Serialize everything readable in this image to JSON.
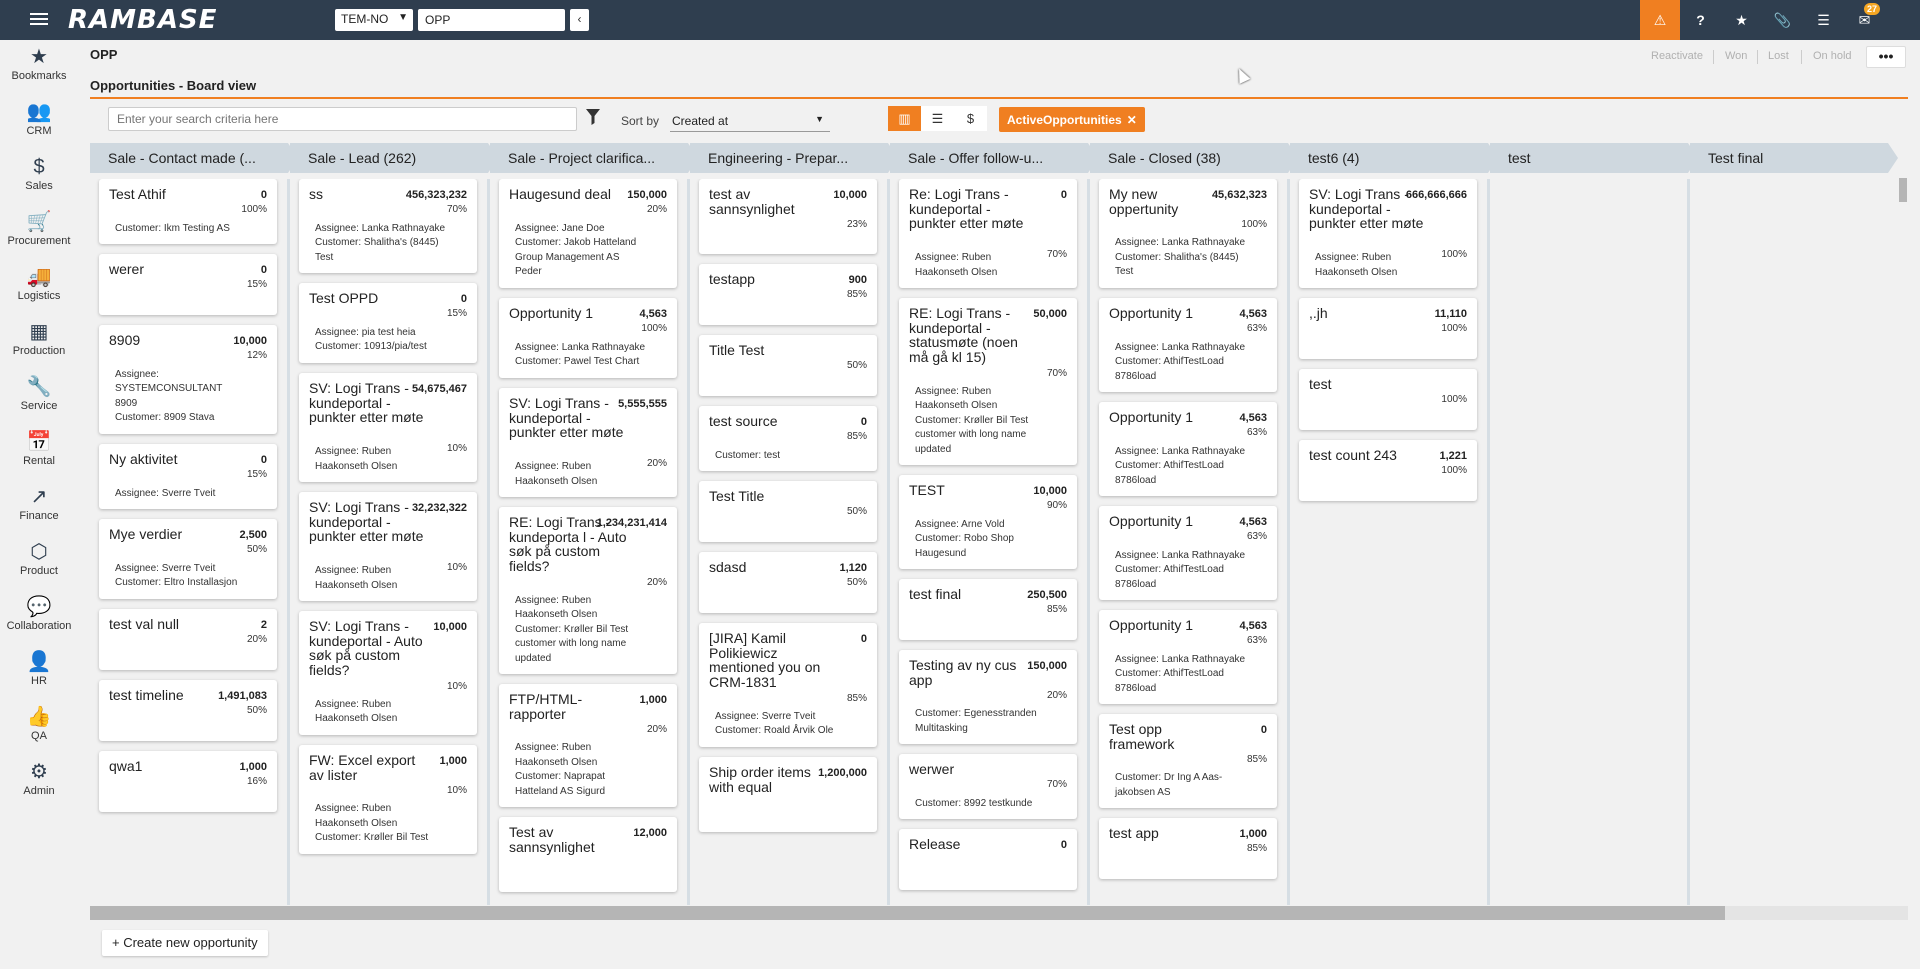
{
  "topbar": {
    "logo": "RAMBASE",
    "company": "TEM-NO",
    "program_input": "OPP",
    "back": "‹",
    "mail_count": "27"
  },
  "sidebar": {
    "items": [
      {
        "icon": "★",
        "label": "Bookmarks"
      },
      {
        "icon": "👥",
        "label": "CRM"
      },
      {
        "icon": "$",
        "label": "Sales"
      },
      {
        "icon": "🛒",
        "label": "Procurement"
      },
      {
        "icon": "🚚",
        "label": "Logistics"
      },
      {
        "icon": "▦",
        "label": "Production"
      },
      {
        "icon": "🔧",
        "label": "Service"
      },
      {
        "icon": "📅",
        "label": "Rental"
      },
      {
        "icon": "↗",
        "label": "Finance"
      },
      {
        "icon": "⬡",
        "label": "Product"
      },
      {
        "icon": "💬",
        "label": "Collaboration"
      },
      {
        "icon": "👤",
        "label": "HR"
      },
      {
        "icon": "👍",
        "label": "QA"
      },
      {
        "icon": "⚙",
        "label": "Admin"
      }
    ]
  },
  "header": {
    "program_title": "OPP",
    "view_title": "Opportunities - Board view",
    "state_buttons": [
      "Reactivate",
      "Won",
      "Lost",
      "On hold"
    ],
    "more": "•••"
  },
  "toolbar": {
    "search_placeholder": "Enter your search criteria here",
    "sort_label": "Sort by",
    "sort_value": "Created at",
    "active_filter": "ActiveOpportunities"
  },
  "columns": [
    {
      "title": "Sale - Contact made (...",
      "cards": [
        {
          "name": "Test Athif",
          "amount": "0",
          "pct": "100%",
          "lines": [
            "Customer: Ikm Testing AS"
          ]
        },
        {
          "name": "werer",
          "amount": "0",
          "pct": "15%",
          "lines": []
        },
        {
          "name": "8909",
          "amount": "10,000",
          "pct": "12%",
          "lines": [
            "Assignee: SYSTEMCONSULTANT 8909",
            "Customer: 8909 Stava"
          ]
        },
        {
          "name": "Ny aktivitet",
          "amount": "0",
          "pct": "15%",
          "lines": [
            "Assignee: Sverre Tveit"
          ]
        },
        {
          "name": "Mye verdier",
          "amount": "2,500",
          "pct": "50%",
          "lines": [
            "Assignee: Sverre Tveit",
            "Customer: Eltro Installasjon"
          ]
        },
        {
          "name": "test val null",
          "amount": "2",
          "pct": "20%",
          "lines": []
        },
        {
          "name": "test timeline",
          "amount": "1,491,083",
          "pct": "50%",
          "lines": []
        },
        {
          "name": "qwa1",
          "amount": "1,000",
          "pct": "16%",
          "lines": []
        }
      ]
    },
    {
      "title": "Sale - Lead (262)",
      "cards": [
        {
          "name": "ss",
          "amount": "456,323,232",
          "pct": "70%",
          "lines": [
            "Assignee: Lanka Rathnayake",
            "Customer: Shalitha's (8445) Test"
          ]
        },
        {
          "name": "Test OPPD",
          "amount": "0",
          "pct": "15%",
          "lines": [
            "Assignee: pia test heia",
            "Customer: 10913/pia/test"
          ]
        },
        {
          "name": "SV: Logi Trans - kundeportal - punkter etter møte",
          "amount": "54,675,467",
          "pct": "10%",
          "lines": [
            "Assignee: Ruben Haakonseth Olsen"
          ]
        },
        {
          "name": "SV: Logi Trans - kundeportal - punkter etter møte",
          "amount": "32,232,322",
          "pct": "10%",
          "lines": [
            "Assignee: Ruben Haakonseth Olsen"
          ]
        },
        {
          "name": "SV: Logi Trans - kundeportal - Auto søk på custom fields?",
          "amount": "10,000",
          "pct": "10%",
          "lines": [
            "Assignee: Ruben Haakonseth Olsen"
          ]
        },
        {
          "name": "FW: Excel export av lister",
          "amount": "1,000",
          "pct": "10%",
          "lines": [
            "Assignee: Ruben Haakonseth Olsen",
            "Customer: Krøller Bil Test"
          ]
        }
      ]
    },
    {
      "title": "Sale - Project clarifica...",
      "cards": [
        {
          "name": "Haugesund deal",
          "amount": "150,000",
          "pct": "20%",
          "lines": [
            "Assignee: Jane Doe",
            "Customer: Jakob Hatteland Group Management AS Peder"
          ]
        },
        {
          "name": "Opportunity 1",
          "amount": "4,563",
          "pct": "100%",
          "lines": [
            "Assignee: Lanka Rathnayake",
            "Customer: Pawel Test Chart"
          ]
        },
        {
          "name": "SV: Logi Trans - kundeportal - punkter etter møte",
          "amount": "5,555,555",
          "pct": "20%",
          "lines": [
            "Assignee: Ruben Haakonseth Olsen"
          ]
        },
        {
          "name": "RE: Logi Trans - kundeporta l - Auto søk på custom fields?",
          "amount": "1,234,231,414",
          "pct": "20%",
          "lines": [
            "Assignee: Ruben Haakonseth Olsen",
            "Customer: Krøller Bil Test customer with long name updated"
          ]
        },
        {
          "name": "FTP/HTML-rapporter",
          "amount": "1,000",
          "pct": "20%",
          "lines": [
            "Assignee: Ruben Haakonseth Olsen",
            "Customer: Naprapat Hatteland AS Sigurd"
          ]
        },
        {
          "name": "Test av sannsynlighet",
          "amount": "12,000",
          "pct": "",
          "lines": []
        }
      ]
    },
    {
      "title": "Engineering - Prepar...",
      "cards": [
        {
          "name": "test av sannsynlighet",
          "amount": "10,000",
          "pct": "23%",
          "lines": []
        },
        {
          "name": "testapp",
          "amount": "900",
          "pct": "85%",
          "lines": []
        },
        {
          "name": "Title Test",
          "amount": "",
          "pct": "50%",
          "lines": []
        },
        {
          "name": "test source",
          "amount": "0",
          "pct": "85%",
          "lines": [
            "Customer: test"
          ]
        },
        {
          "name": "Test Title",
          "amount": "",
          "pct": "50%",
          "lines": []
        },
        {
          "name": "sdasd",
          "amount": "1,120",
          "pct": "50%",
          "lines": []
        },
        {
          "name": "[JIRA] Kamil Polikiewicz mentioned you on CRM-1831",
          "amount": "0",
          "pct": "85%",
          "lines": [
            "Assignee: Sverre Tveit",
            "Customer: Roald Årvik Ole"
          ]
        },
        {
          "name": "Ship order items with equal",
          "amount": "1,200,000",
          "pct": "",
          "lines": []
        }
      ]
    },
    {
      "title": "Sale - Offer follow-u...",
      "cards": [
        {
          "name": "Re: Logi Trans - kundeportal - punkter etter møte",
          "amount": "0",
          "pct": "70%",
          "lines": [
            "Assignee: Ruben Haakonseth Olsen"
          ]
        },
        {
          "name": "RE: Logi Trans - kundeportal - statusmøte (noen må gå kl 15)",
          "amount": "50,000",
          "pct": "70%",
          "lines": [
            "Assignee: Ruben Haakonseth Olsen",
            "Customer: Krøller Bil Test customer with long name updated"
          ]
        },
        {
          "name": "TEST",
          "amount": "10,000",
          "pct": "90%",
          "lines": [
            "Assignee: Arne Vold",
            "Customer: Robo Shop Haugesund"
          ]
        },
        {
          "name": "test final",
          "amount": "250,500",
          "pct": "85%",
          "lines": []
        },
        {
          "name": "Testing av ny cus app",
          "amount": "150,000",
          "pct": "20%",
          "lines": [
            "Customer: Egenesstranden Multitasking"
          ]
        },
        {
          "name": "werwer",
          "amount": "",
          "pct": "70%",
          "lines": [
            "Customer: 8992 testkunde"
          ]
        },
        {
          "name": "Release",
          "amount": "0",
          "pct": "",
          "lines": []
        }
      ]
    },
    {
      "title": "Sale - Closed (38)",
      "cards": [
        {
          "name": "My new oppertunity",
          "amount": "45,632,323",
          "pct": "100%",
          "lines": [
            "Assignee: Lanka Rathnayake",
            "Customer: Shalitha's (8445) Test"
          ]
        },
        {
          "name": "Opportunity 1",
          "amount": "4,563",
          "pct": "63%",
          "lines": [
            "Assignee: Lanka Rathnayake",
            "Customer: AthifTestLoad 8786load"
          ]
        },
        {
          "name": "Opportunity 1",
          "amount": "4,563",
          "pct": "63%",
          "lines": [
            "Assignee: Lanka Rathnayake",
            "Customer: AthifTestLoad 8786load"
          ]
        },
        {
          "name": "Opportunity 1",
          "amount": "4,563",
          "pct": "63%",
          "lines": [
            "Assignee: Lanka Rathnayake",
            "Customer: AthifTestLoad 8786load"
          ]
        },
        {
          "name": "Opportunity 1",
          "amount": "4,563",
          "pct": "63%",
          "lines": [
            "Assignee: Lanka Rathnayake",
            "Customer: AthifTestLoad 8786load"
          ]
        },
        {
          "name": "Test opp framework",
          "amount": "0",
          "pct": "85%",
          "lines": [
            "Customer: Dr Ing A Aas-jakobsen AS"
          ]
        },
        {
          "name": "test app",
          "amount": "1,000",
          "pct": "85%",
          "lines": []
        }
      ]
    },
    {
      "title": "test6 (4)",
      "cards": [
        {
          "name": "SV: Logi Trans - kundeportal - punkter etter møte",
          "amount": "666,666,666",
          "pct": "100%",
          "lines": [
            "Assignee: Ruben Haakonseth Olsen"
          ]
        },
        {
          "name": ",.jh",
          "amount": "11,110",
          "pct": "100%",
          "lines": []
        },
        {
          "name": "test",
          "amount": "",
          "pct": "100%",
          "lines": []
        },
        {
          "name": "test count 243",
          "amount": "1,221",
          "pct": "100%",
          "lines": []
        }
      ]
    },
    {
      "title": "test",
      "cards": []
    },
    {
      "title": "Test final",
      "cards": []
    }
  ],
  "footer": {
    "create_label": "Create new opportunity"
  }
}
